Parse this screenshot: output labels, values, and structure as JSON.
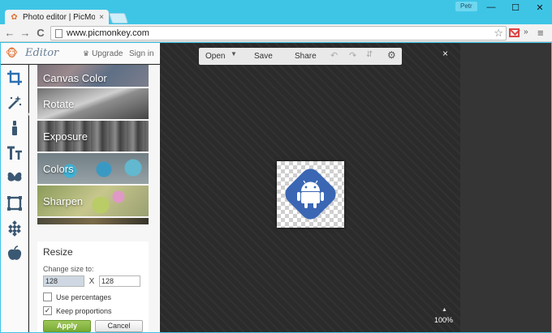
{
  "browser": {
    "tab_title": "Photo editor | PicMonkey",
    "tab_close": "×",
    "user_name": "Petr",
    "window_controls": {
      "minimize": "—",
      "maximize": "☐",
      "close": "✕"
    },
    "nav": {
      "back": "←",
      "forward": "→",
      "reload": "C"
    },
    "url": "www.picmonkey.com",
    "bookmark_star": "☆",
    "more_extensions": "»",
    "menu": "≡"
  },
  "app": {
    "logo_text": "Editor",
    "upgrade_label": "Upgrade",
    "signin_label": "Sign in",
    "rail_icons": [
      "crop-icon",
      "magic-wand-icon",
      "brush-icon",
      "text-icon",
      "butterfly-icon",
      "frame-icon",
      "texture-icon",
      "apple-icon"
    ],
    "panel_items": [
      {
        "label": "Canvas Color"
      },
      {
        "label": "Rotate"
      },
      {
        "label": "Exposure"
      },
      {
        "label": "Colors"
      },
      {
        "label": "Sharpen"
      }
    ],
    "resize": {
      "title": "Resize",
      "subtitle": "Change size to:",
      "width_value": "128",
      "separator": "X",
      "height_value": "128",
      "use_percentages_label": "Use percentages",
      "use_percentages_checked": false,
      "keep_proportions_label": "Keep proportions",
      "keep_proportions_checked": true,
      "apply_label": "Apply",
      "cancel_label": "Cancel"
    },
    "editor_toolbar": {
      "open_label": "Open",
      "save_label": "Save",
      "share_label": "Share"
    },
    "close_label": "×",
    "zoom_label": "100%",
    "accent_color": "#3a66b4",
    "apply_color": "#8cbb45"
  }
}
